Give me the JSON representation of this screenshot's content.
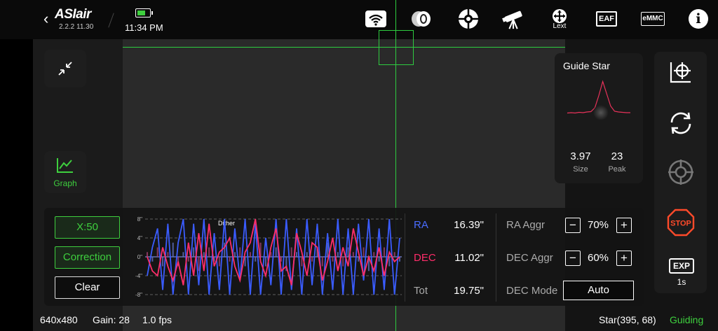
{
  "header": {
    "back_glyph": "‹",
    "logo": "ASIair",
    "version": "2.2.2 11.30",
    "time": "11:34 PM",
    "battery_level": 0.7,
    "icons": [
      "wifi-icon",
      "focuser-icon",
      "mount-icon",
      "telescope-icon",
      "lext-icon",
      "eaf-icon",
      "emmc-icon",
      "info-icon"
    ],
    "lext_label": "Lext",
    "eaf_label": "EAF",
    "emmc_label": "eMMC",
    "info_label": "i"
  },
  "left": {
    "graph_label": "Graph"
  },
  "guide_star": {
    "title": "Guide Star",
    "size_value": "3.97",
    "size_label": "Size",
    "peak_value": "23",
    "peak_label": "Peak",
    "profile": [
      0.05,
      0.06,
      0.05,
      0.07,
      0.06,
      0.08,
      0.09,
      0.2,
      0.55,
      0.95,
      0.6,
      0.25,
      0.1,
      0.08,
      0.07,
      0.06,
      0.06
    ]
  },
  "right_toolbar": {
    "icons": [
      "calibrate-icon",
      "loop-icon",
      "target-icon",
      "stop-icon"
    ],
    "stop_label": "STOP",
    "exp_label": "EXP",
    "exp_value": "1s"
  },
  "graph_panel": {
    "x_button": "X:50",
    "correction_button": "Correction",
    "clear_button": "Clear",
    "dither_label": "Dither",
    "ra_label": "RA",
    "ra_value": "16.39\"",
    "dec_label": "DEC",
    "dec_value": "11.02\"",
    "tot_label": "Tot",
    "tot_value": "19.75\"",
    "ra_aggr_label": "RA Aggr",
    "ra_aggr_value": "70%",
    "dec_aggr_label": "DEC Aggr",
    "dec_aggr_value": "60%",
    "dec_mode_label": "DEC Mode",
    "dec_mode_value": "Auto",
    "minus": "−",
    "plus": "+"
  },
  "chart_data": {
    "type": "line",
    "y_ticks": [
      "8\"",
      "4\"",
      "0\"",
      "-4\"",
      "-8\""
    ],
    "ylim": [
      -8,
      8
    ],
    "colors": {
      "ra": "#3a5cff",
      "dec": "#ff2d6a"
    },
    "series": [
      {
        "name": "RA",
        "values": [
          -4,
          2,
          6,
          -7,
          7,
          -8,
          3,
          8,
          -8,
          7,
          -6,
          8,
          -8,
          5,
          -7,
          8,
          -8,
          6,
          -5,
          8,
          -8,
          7,
          -8,
          4,
          -6,
          8,
          -8,
          8,
          -7,
          6,
          -8,
          8,
          -6,
          7,
          -8,
          5,
          -7,
          8,
          -8,
          6,
          -8,
          7,
          -5,
          8,
          -8,
          6,
          -7,
          8,
          -8,
          4
        ]
      },
      {
        "name": "DEC",
        "values": [
          0,
          -3,
          -4,
          2,
          -2,
          -5,
          -1,
          -6,
          3,
          -4,
          5,
          -3,
          7,
          -2,
          1,
          2,
          4,
          -2,
          -5,
          1,
          3,
          8,
          -1,
          -4,
          2,
          6,
          -3,
          -2,
          -6,
          5,
          1,
          -4,
          3,
          2,
          -5,
          -1,
          4,
          -3,
          2,
          -2,
          6,
          1,
          -4,
          0,
          -3,
          2,
          -4,
          1,
          -1,
          0
        ]
      }
    ],
    "bars": [
      1,
      -1,
      2,
      -2,
      1,
      3,
      -2,
      1,
      -1,
      2,
      -3,
      1,
      2,
      -1,
      -2,
      3,
      -1,
      1,
      2,
      -2,
      1,
      -1,
      3,
      -2,
      1,
      2,
      -1,
      -3,
      2,
      1,
      -2,
      1,
      -1,
      2,
      -2,
      3,
      -1,
      1,
      -2,
      2,
      1,
      -1,
      2,
      -3,
      1,
      -1,
      2,
      -2,
      1,
      -1
    ]
  },
  "status_bar": {
    "resolution": "640x480",
    "gain": "Gain: 28",
    "fps": "1.0 fps",
    "star": "Star(395, 68)",
    "state": "Guiding"
  }
}
